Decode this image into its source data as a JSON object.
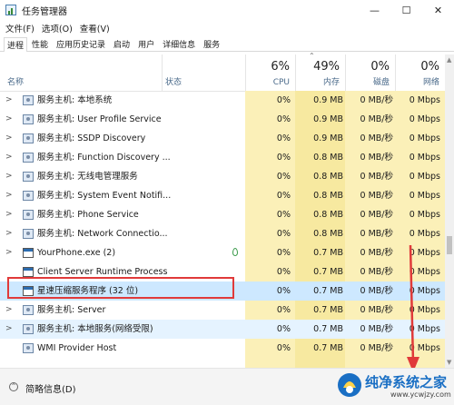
{
  "window": {
    "title": "任务管理器",
    "minimize": "—",
    "maximize": "☐",
    "close": "✕"
  },
  "menu": [
    "文件(F)",
    "选项(O)",
    "查看(V)"
  ],
  "tabs": [
    "进程",
    "性能",
    "应用历史记录",
    "启动",
    "用户",
    "详细信息",
    "服务"
  ],
  "columns": {
    "name": "名称",
    "status": "状态",
    "cpu": {
      "pct": "6%",
      "label": "CPU"
    },
    "memory": {
      "pct": "49%",
      "label": "内存"
    },
    "disk": {
      "pct": "0%",
      "label": "磁盘"
    },
    "network": {
      "pct": "0%",
      "label": "网络"
    }
  },
  "rows": [
    {
      "name": "服务主机: 本地系统",
      "cpu": "0%",
      "mem": "0.9 MB",
      "disk": "0 MB/秒",
      "net": "0 Mbps",
      "expand": ">",
      "icon": "service"
    },
    {
      "name": "服务主机: User Profile Service",
      "cpu": "0%",
      "mem": "0.9 MB",
      "disk": "0 MB/秒",
      "net": "0 Mbps",
      "expand": ">",
      "icon": "service"
    },
    {
      "name": "服务主机: SSDP Discovery",
      "cpu": "0%",
      "mem": "0.9 MB",
      "disk": "0 MB/秒",
      "net": "0 Mbps",
      "expand": ">",
      "icon": "service"
    },
    {
      "name": "服务主机: Function Discovery ...",
      "cpu": "0%",
      "mem": "0.8 MB",
      "disk": "0 MB/秒",
      "net": "0 Mbps",
      "expand": ">",
      "icon": "service"
    },
    {
      "name": "服务主机: 无线电管理服务",
      "cpu": "0%",
      "mem": "0.8 MB",
      "disk": "0 MB/秒",
      "net": "0 Mbps",
      "expand": ">",
      "icon": "service"
    },
    {
      "name": "服务主机: System Event Notifi...",
      "cpu": "0%",
      "mem": "0.8 MB",
      "disk": "0 MB/秒",
      "net": "0 Mbps",
      "expand": ">",
      "icon": "service"
    },
    {
      "name": "服务主机: Phone Service",
      "cpu": "0%",
      "mem": "0.8 MB",
      "disk": "0 MB/秒",
      "net": "0 Mbps",
      "expand": ">",
      "icon": "service"
    },
    {
      "name": "服务主机: Network Connectio...",
      "cpu": "0%",
      "mem": "0.8 MB",
      "disk": "0 MB/秒",
      "net": "0 Mbps",
      "expand": ">",
      "icon": "service"
    },
    {
      "name": "YourPhone.exe (2)",
      "cpu": "0%",
      "mem": "0.7 MB",
      "disk": "0 MB/秒",
      "net": "0 Mbps",
      "expand": ">",
      "icon": "process",
      "leaf": true
    },
    {
      "name": "Client Server Runtime Process",
      "cpu": "0%",
      "mem": "0.7 MB",
      "disk": "0 MB/秒",
      "net": "0 Mbps",
      "expand": "",
      "icon": "process"
    },
    {
      "name": "星速压缩服务程序 (32 位)",
      "cpu": "0%",
      "mem": "0.7 MB",
      "disk": "0 MB/秒",
      "net": "0 Mbps",
      "expand": "",
      "icon": "process",
      "selected": true
    },
    {
      "name": "服务主机: Server",
      "cpu": "0%",
      "mem": "0.7 MB",
      "disk": "0 MB/秒",
      "net": "0 Mbps",
      "expand": ">",
      "icon": "service"
    },
    {
      "name": "服务主机: 本地服务(网络受限)",
      "cpu": "0%",
      "mem": "0.7 MB",
      "disk": "0 MB/秒",
      "net": "0 Mbps",
      "expand": ">",
      "icon": "service",
      "hover": true
    },
    {
      "name": "WMI Provider Host",
      "cpu": "0%",
      "mem": "0.7 MB",
      "disk": "0 MB/秒",
      "net": "0 Mbps",
      "expand": "",
      "icon": "service"
    }
  ],
  "footer": {
    "label": "简略信息(D)",
    "chevron": "^"
  },
  "watermark": {
    "name": "纯净系统之家",
    "url": "www.ycwjzy.com"
  },
  "colors": {
    "highlight_box": "#e03a3a",
    "cpu_bg": "#fbf0b8",
    "mem_bg": "#f7e9a0",
    "selected_row": "#cde8ff"
  }
}
